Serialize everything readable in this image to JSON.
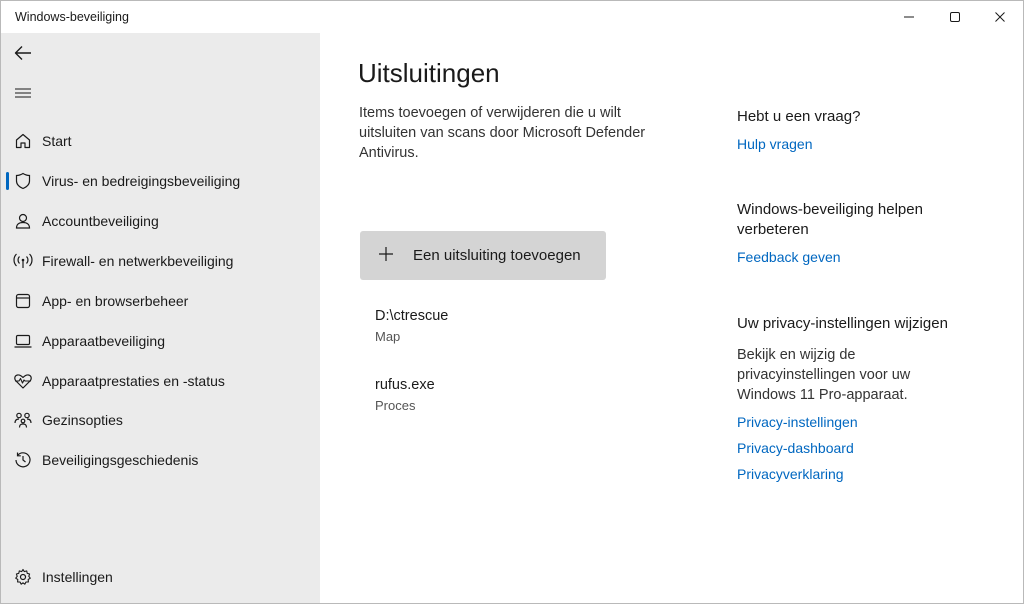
{
  "window": {
    "title": "Windows-beveiliging"
  },
  "sidebar": {
    "items": [
      {
        "label": "Start",
        "icon": "home-icon"
      },
      {
        "label": "Virus- en bedreigingsbeveiliging",
        "icon": "shield-icon",
        "selected": true
      },
      {
        "label": "Accountbeveiliging",
        "icon": "person-icon"
      },
      {
        "label": "Firewall- en netwerkbeveiliging",
        "icon": "wireless-icon"
      },
      {
        "label": "App- en browserbeheer",
        "icon": "browser-window-icon"
      },
      {
        "label": "Apparaatbeveiliging",
        "icon": "laptop-icon"
      },
      {
        "label": "Apparaatprestaties en -status",
        "icon": "heart-pulse-icon"
      },
      {
        "label": "Gezinsopties",
        "icon": "family-icon"
      },
      {
        "label": "Beveiligingsgeschiedenis",
        "icon": "history-icon"
      }
    ],
    "settings_label": "Instellingen"
  },
  "main": {
    "title": "Uitsluitingen",
    "description": "Items toevoegen of verwijderen die u wilt uitsluiten van scans door Microsoft Defender Antivirus.",
    "add_button_label": "Een uitsluiting toevoegen",
    "exclusions": [
      {
        "name": "D:\\ctrescue",
        "type": "Map"
      },
      {
        "name": "rufus.exe",
        "type": "Proces"
      }
    ]
  },
  "aside": {
    "question_heading": "Hebt u een vraag?",
    "help_link": "Hulp vragen",
    "improve_heading": "Windows-beveiliging helpen verbeteren",
    "feedback_link": "Feedback geven",
    "privacy_heading": "Uw privacy-instellingen wijzigen",
    "privacy_text": "Bekijk en wijzig de privacyinstellingen voor uw Windows 11 Pro-apparaat.",
    "privacy_links": [
      "Privacy-instellingen",
      "Privacy-dashboard",
      "Privacyverklaring"
    ]
  },
  "colors": {
    "accent": "#0067c0",
    "sidebar_bg": "#ebebeb",
    "button_bg": "#d4d4d4"
  }
}
